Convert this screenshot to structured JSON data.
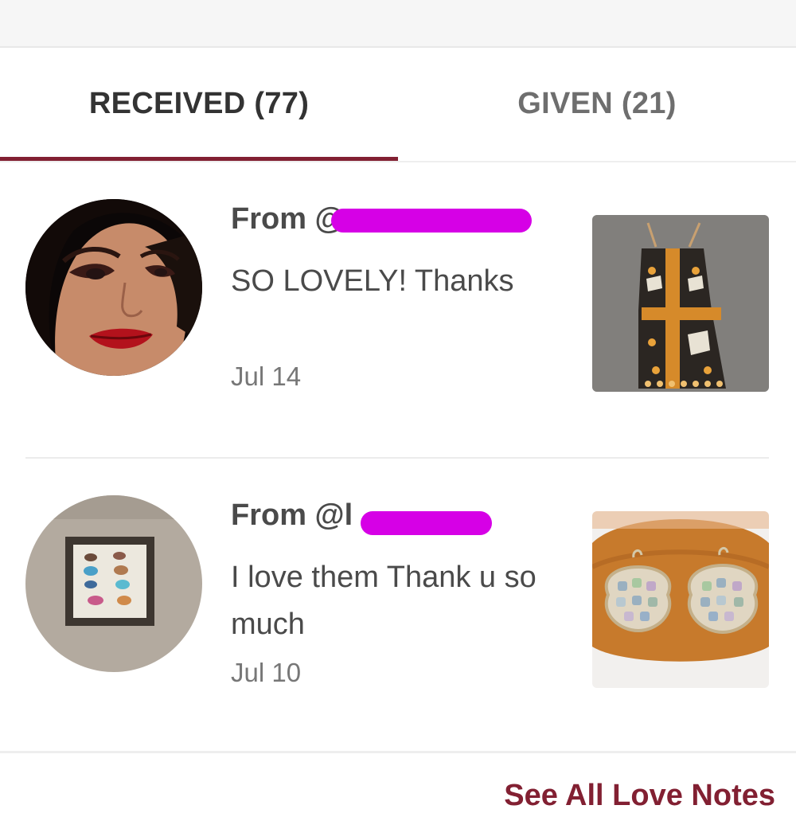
{
  "tabs": {
    "received": "RECEIVED (77)",
    "given": "GIVEN (21)",
    "active": "received"
  },
  "notes": [
    {
      "from": "From @",
      "message": "SO LOVELY! Thanks",
      "date": "Jul 14",
      "avatar_icon": "woman-portrait",
      "item_icon": "patterned-dress"
    },
    {
      "from": "From @l",
      "message": "I love them Thank u so much",
      "date": "Jul 10",
      "avatar_icon": "butterfly-frame",
      "item_icon": "abalone-earrings"
    }
  ],
  "footer": {
    "see_all": "See All Love Notes"
  },
  "colors": {
    "accent": "#822032",
    "redaction": "#d600e6",
    "text": "#4a4a4a",
    "muted": "#777777"
  }
}
